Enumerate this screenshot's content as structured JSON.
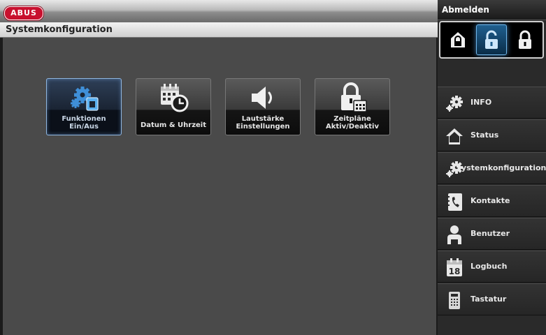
{
  "header": {
    "logo_text": "ABUS",
    "page_title": "Systemkonfiguration"
  },
  "tiles": [
    {
      "id": "funktionen",
      "line1": "Funktionen",
      "line2": "Ein/Aus",
      "icon": "gears-switch-icon",
      "active": true
    },
    {
      "id": "datum",
      "line1": "Datum & Uhrzeit",
      "line2": "",
      "icon": "calendar-clock-icon",
      "active": false
    },
    {
      "id": "lautstaerke",
      "line1": "Lautstärke",
      "line2": "Einstellungen",
      "icon": "speaker-icon",
      "active": false
    },
    {
      "id": "zeitplaene",
      "line1": "Zeitpläne",
      "line2": "Aktiv/Deaktiv",
      "icon": "lock-calendar-icon",
      "active": false
    }
  ],
  "sidebar": {
    "logout_label": "Abmelden",
    "modes": [
      {
        "icon": "house-lock-icon",
        "selected": false
      },
      {
        "icon": "padlock-open-icon",
        "selected": true
      },
      {
        "icon": "padlock-closed-icon",
        "selected": false
      }
    ],
    "items": [
      {
        "label": "INFO",
        "icon": "gears-icon"
      },
      {
        "label": "Status",
        "icon": "house-icon"
      },
      {
        "label": "Systemkonfiguration",
        "icon": "gears-icon"
      },
      {
        "label": "Kontakte",
        "icon": "phone-book-icon"
      },
      {
        "label": "Benutzer",
        "icon": "user-icon"
      },
      {
        "label": "Logbuch",
        "icon": "calendar-18-icon"
      },
      {
        "label": "Tastatur",
        "icon": "keypad-icon"
      }
    ]
  },
  "colors": {
    "accent": "#6fb6ea",
    "brand_red": "#c8102e",
    "panel": "#4a4a4a"
  }
}
